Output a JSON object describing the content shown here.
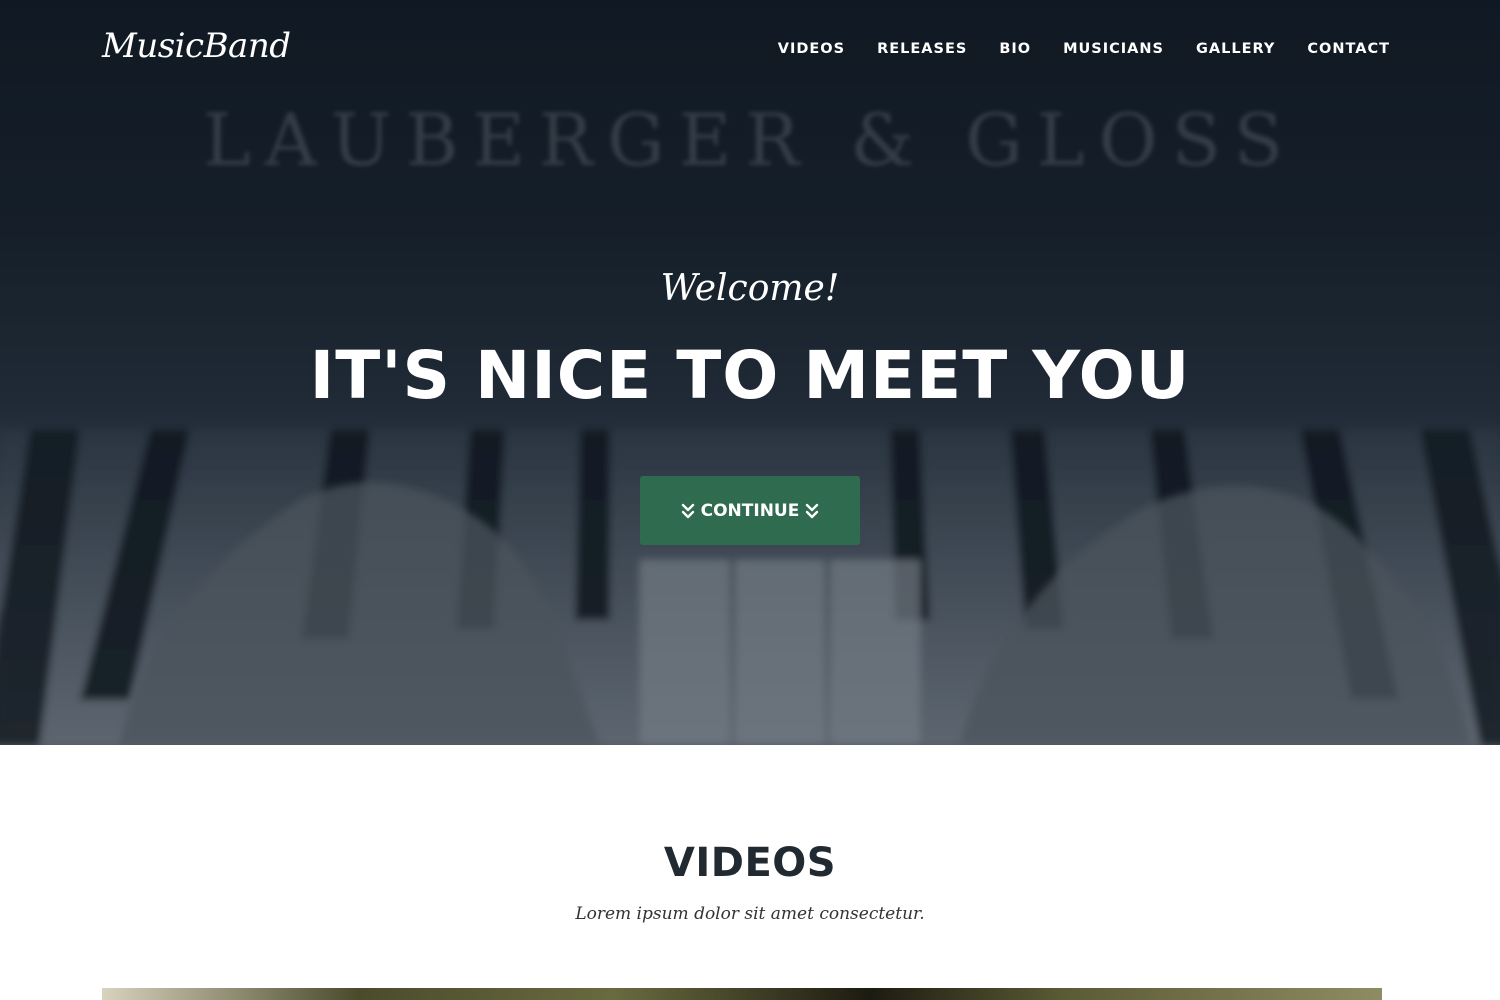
{
  "brand": {
    "name": "MusicBand"
  },
  "nav": {
    "items": [
      {
        "label": "VIDEOS"
      },
      {
        "label": "RELEASES"
      },
      {
        "label": "BIO"
      },
      {
        "label": "MUSICIANS"
      },
      {
        "label": "GALLERY"
      },
      {
        "label": "CONTACT"
      }
    ]
  },
  "hero": {
    "background_text": "LAUBERGER & GLOSS",
    "welcome": "Welcome!",
    "heading": "IT'S NICE TO MEET YOU",
    "button_label": "CONTINUE",
    "button_icon": "double-chevron-down-icon",
    "button_color": "#2f6b4f"
  },
  "videos": {
    "title": "VIDEOS",
    "subtitle": "Lorem ipsum dolor sit amet consectetur."
  }
}
